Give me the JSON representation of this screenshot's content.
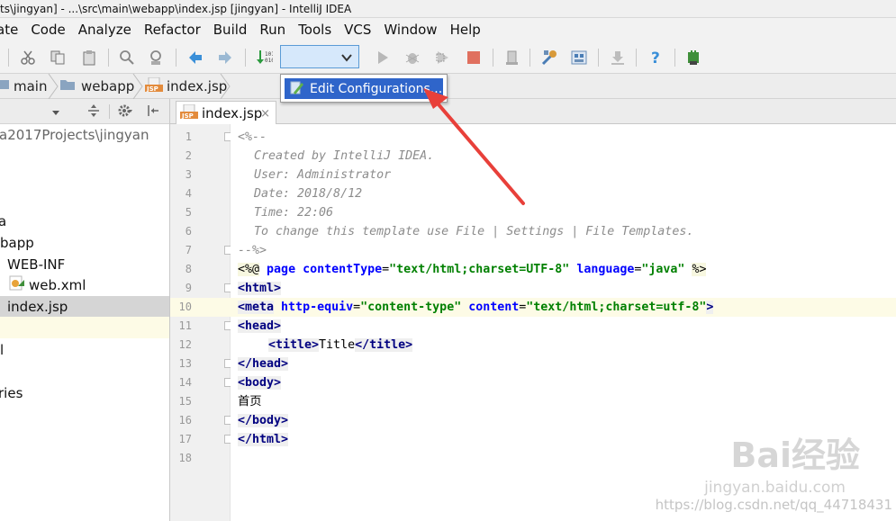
{
  "window": {
    "title": "ts\\jingyan] - ...\\src\\main\\webapp\\index.jsp [jingyan] - IntelliJ IDEA"
  },
  "menubar": {
    "items": [
      "ate",
      "Code",
      "Analyze",
      "Refactor",
      "Build",
      "Run",
      "Tools",
      "VCS",
      "Window",
      "Help"
    ]
  },
  "toolbar": {
    "run_config_value": "",
    "icons": [
      "cut-icon",
      "copy-icon",
      "paste-icon",
      "find-icon",
      "replace-icon",
      "back-icon",
      "forward-icon",
      "make-icon",
      "run-icon",
      "debug-icon",
      "coverage-icon",
      "stop-icon",
      "vcs-icon",
      "settings-icon",
      "project-structure-icon",
      "sdk-icon",
      "help-icon",
      "plugin-icon"
    ]
  },
  "dropdown": {
    "item_label": "Edit Configurations..."
  },
  "breadcrumbs": {
    "items": [
      "main",
      "webapp",
      "index.jsp"
    ]
  },
  "project": {
    "path": "a2017Projects\\jingyan",
    "tree": [
      {
        "label": "a",
        "type": "folder"
      },
      {
        "label": "bapp",
        "type": "folder"
      },
      {
        "label": "WEB-INF",
        "type": "folder"
      },
      {
        "label": "web.xml",
        "type": "file"
      },
      {
        "label": "index.jsp",
        "type": "file"
      },
      {
        "label": "l",
        "type": "folder"
      },
      {
        "label": "ries",
        "type": "folder"
      }
    ]
  },
  "editor": {
    "tab_label": "index.jsp",
    "tab_close": "×",
    "line_numbers": [
      "1",
      "2",
      "3",
      "4",
      "5",
      "6",
      "7",
      "8",
      "9",
      "10",
      "11",
      "12",
      "13",
      "14",
      "15",
      "16",
      "17",
      "18"
    ],
    "comment_open": "<%--",
    "comment_created": "Created by IntelliJ IDEA.",
    "comment_user": "User: Administrator",
    "comment_date": "Date: 2018/8/12",
    "comment_time": "Time: 22:06",
    "comment_template": "To change this template use File | Settings | File Templates.",
    "comment_close": "--%>",
    "directive_open": "<%@",
    "directive_page": "page",
    "attr_contentType": "contentType",
    "val_contentType": "\"text/html;charset=UTF-8\"",
    "attr_language": "language",
    "val_language": "\"java\"",
    "directive_close": "%>",
    "tag_html_open": "<html>",
    "tag_meta": "<meta",
    "attr_http_equiv": "http-equiv",
    "val_http_equiv": "\"content-type\"",
    "attr_content": "content",
    "val_content": "\"text/html;charset=utf-8\"",
    "tag_gt": ">",
    "tag_head_open": "<head>",
    "tag_title_open": "<title>",
    "title_text": "Title",
    "tag_title_close": "</title>",
    "tag_head_close": "</head>",
    "tag_body_open": "<body>",
    "body_text": "首页",
    "tag_body_close": "</body>",
    "tag_html_close": "</html>",
    "eq": "="
  },
  "watermark": {
    "brand": "Bai经验",
    "sub": "jingyan.baidu.com",
    "url": "https://blog.csdn.net/qq_44718431"
  },
  "colors": {
    "accent": "#2f65ca",
    "annotation": "#e8403a"
  }
}
